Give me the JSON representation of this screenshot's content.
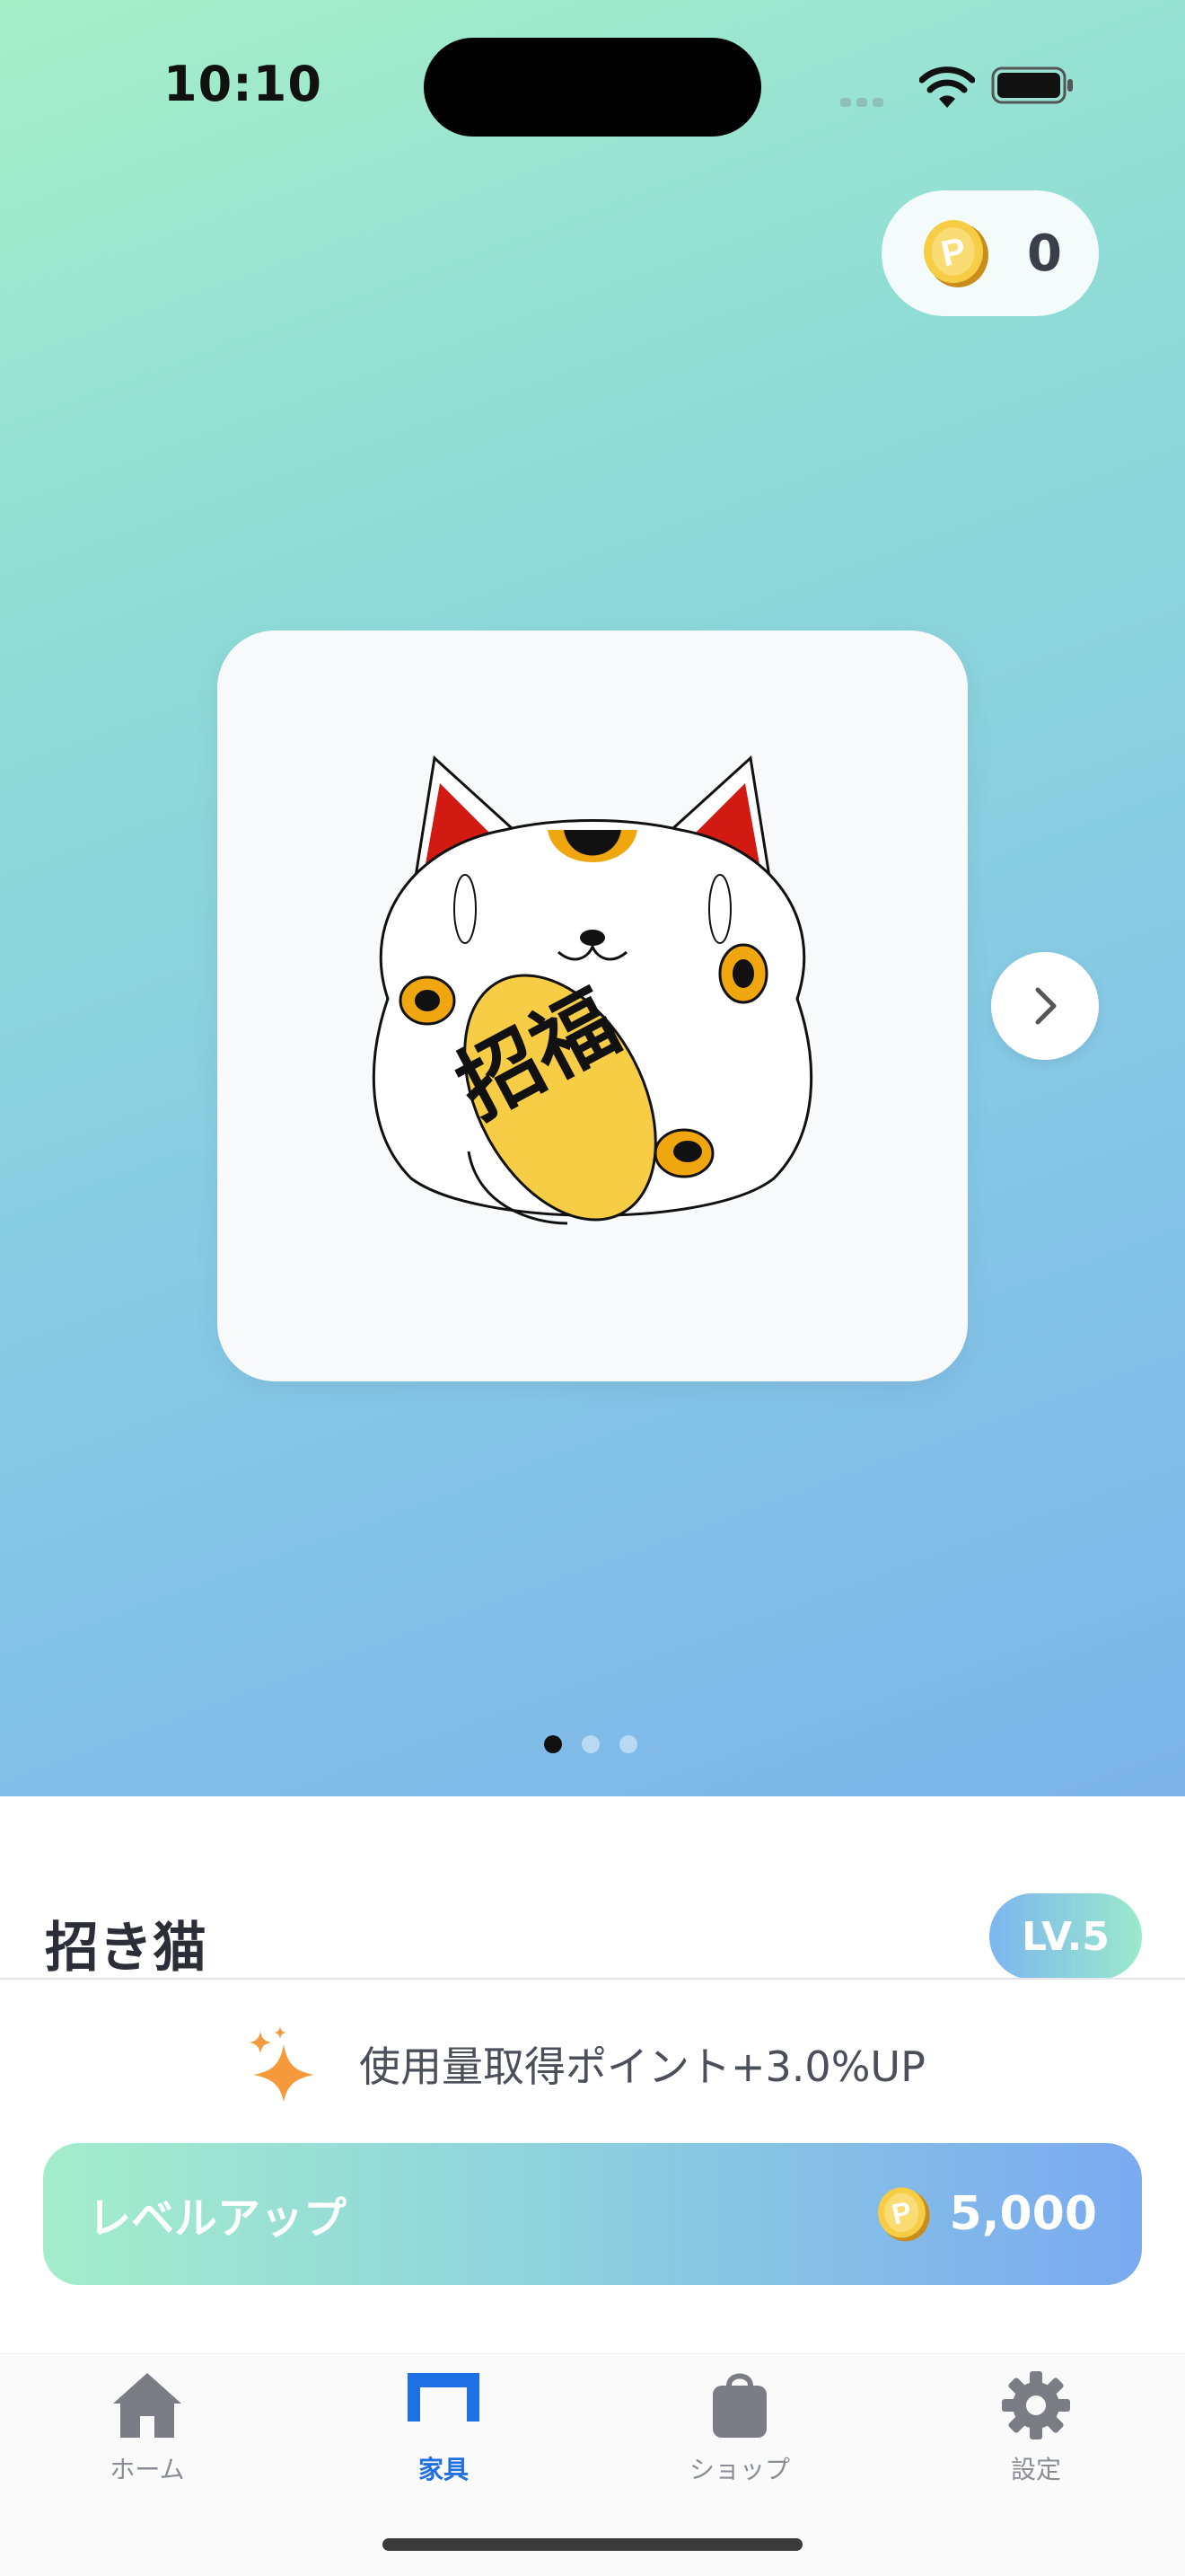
{
  "status_bar": {
    "time": "10:10"
  },
  "points": {
    "value": "0",
    "icon": "p-coin-icon"
  },
  "carousel": {
    "item_image": "maneki-neko",
    "card_text": "招福",
    "next_icon": "chevron-right-icon",
    "page_count": 3,
    "current_page": 1
  },
  "item": {
    "name": "招き猫",
    "level": "LV.5",
    "effect_icon": "sparkle-icon",
    "effect": "使用量取得ポイント+3.0%UP"
  },
  "level_up": {
    "label": "レベルアップ",
    "cost": "5,000"
  },
  "tabs": [
    {
      "label": "ホーム",
      "icon": "home-icon",
      "active": false
    },
    {
      "label": "家具",
      "icon": "furniture-icon",
      "active": true
    },
    {
      "label": "ショップ",
      "icon": "shopping-bag-icon",
      "active": false
    },
    {
      "label": "設定",
      "icon": "gear-icon",
      "active": false
    }
  ],
  "colors": {
    "accent": "#1f6fe5",
    "gradient_start": "#a6efc9",
    "gradient_end": "#7cb4ea",
    "coin": "#f5c53a"
  }
}
